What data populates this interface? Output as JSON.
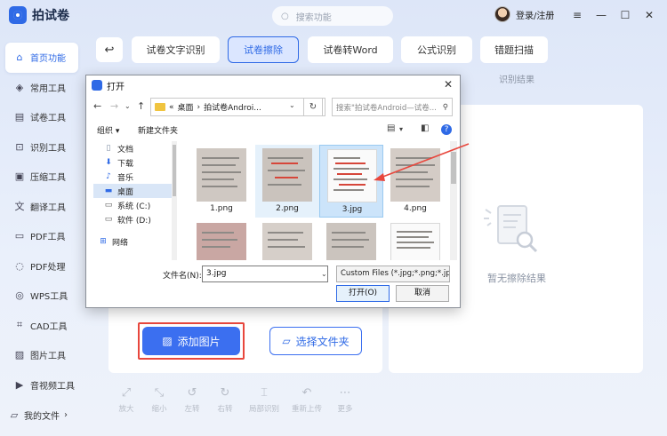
{
  "app": {
    "name": "拍试卷",
    "search_placeholder": "搜索功能",
    "user_label": "登录/注册"
  },
  "sidebar": {
    "items": [
      {
        "label": "首页功能",
        "icon": "home-icon",
        "active": true
      },
      {
        "label": "常用工具",
        "icon": "layers-icon"
      },
      {
        "label": "试卷工具",
        "icon": "paper-icon"
      },
      {
        "label": "识别工具",
        "icon": "scan-icon"
      },
      {
        "label": "压缩工具",
        "icon": "compress-icon"
      },
      {
        "label": "翻译工具",
        "icon": "translate-icon"
      },
      {
        "label": "PDF工具",
        "icon": "pdf-icon"
      },
      {
        "label": "PDF处理",
        "icon": "pdf-process-icon"
      },
      {
        "label": "WPS工具",
        "icon": "wps-icon"
      },
      {
        "label": "CAD工具",
        "icon": "cad-icon"
      },
      {
        "label": "图片工具",
        "icon": "image-icon"
      },
      {
        "label": "音视频工具",
        "icon": "media-icon"
      }
    ],
    "my_files": "我的文件"
  },
  "tabs": [
    {
      "label": "试卷文字识别"
    },
    {
      "label": "试卷擦除",
      "active": true
    },
    {
      "label": "试卷转Word"
    },
    {
      "label": "公式识别"
    },
    {
      "label": "错题扫描"
    }
  ],
  "results": {
    "header": "识别结果",
    "empty_text": "暂无擦除结果"
  },
  "actions": {
    "add_image": "添加图片",
    "select_folder": "选择文件夹"
  },
  "toolbar": [
    {
      "label": "放大",
      "icon": "zoom-in-icon"
    },
    {
      "label": "缩小",
      "icon": "zoom-out-icon"
    },
    {
      "label": "左转",
      "icon": "rotate-left-icon"
    },
    {
      "label": "右转",
      "icon": "rotate-right-icon"
    },
    {
      "label": "局部识别",
      "icon": "crop-icon"
    },
    {
      "label": "重新上传",
      "icon": "reupload-icon"
    },
    {
      "label": "更多",
      "icon": "more-icon"
    }
  ],
  "dialog": {
    "title": "打开",
    "address": {
      "prefix": "«",
      "crumb1": "桌面",
      "sep": "›",
      "crumb2": "拍试卷Androi..."
    },
    "search_placeholder": "搜索\"拍试卷Android—试卷...",
    "organize": "组织",
    "new_folder": "新建文件夹",
    "tree": [
      {
        "label": "文档",
        "icon": "document-icon"
      },
      {
        "label": "下载",
        "icon": "download-icon"
      },
      {
        "label": "音乐",
        "icon": "music-icon"
      },
      {
        "label": "桌面",
        "icon": "desktop-icon",
        "selected": true
      },
      {
        "label": "系统 (C:)",
        "icon": "drive-icon"
      },
      {
        "label": "软件 (D:)",
        "icon": "drive-icon"
      },
      {
        "label": "网络",
        "icon": "network-icon"
      }
    ],
    "files": [
      {
        "name": "1.png"
      },
      {
        "name": "2.png"
      },
      {
        "name": "3.jpg",
        "selected": true
      },
      {
        "name": "4.png"
      },
      {
        "name": ""
      },
      {
        "name": ""
      },
      {
        "name": ""
      },
      {
        "name": ""
      }
    ],
    "filename_label": "文件名(N):",
    "filename_value": "3.jpg",
    "filter": "Custom Files (*.jpg;*.png;*.jp",
    "open": "打开(O)",
    "cancel": "取消"
  },
  "colors": {
    "accent": "#2f6ae6",
    "highlight_red": "#e8473d"
  }
}
